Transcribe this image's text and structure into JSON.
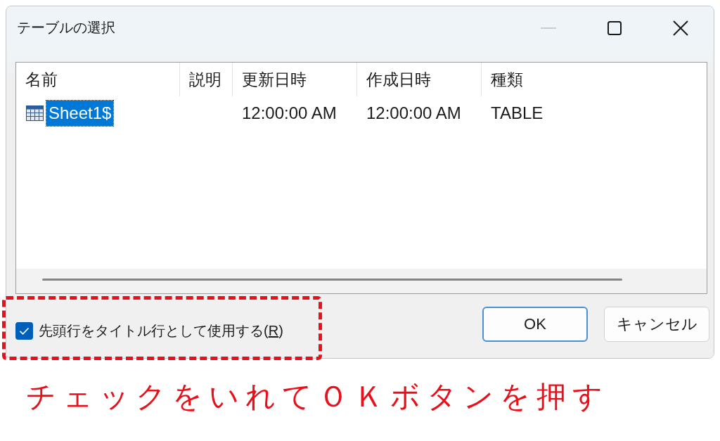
{
  "window": {
    "title": "テーブルの選択",
    "minimize_disabled": true
  },
  "table": {
    "columns": [
      {
        "label": "名前"
      },
      {
        "label": "説明"
      },
      {
        "label": "更新日時"
      },
      {
        "label": "作成日時"
      },
      {
        "label": "種類"
      }
    ],
    "rows": [
      {
        "name": "Sheet1$",
        "modified": "12:00:00 AM",
        "created": "12:00:00 AM",
        "type": "TABLE",
        "selected": true
      }
    ]
  },
  "header_row_option": {
    "label_before": "先頭行をタイトル行として使用する(",
    "access_key": "R",
    "label_after": ")",
    "checked": true
  },
  "buttons": [
    {
      "label": "OK",
      "default": true
    },
    {
      "label": "キャンセル",
      "default": false
    }
  ],
  "annotation": {
    "caption": "チェックをいれてＯＫボタンを押す"
  }
}
